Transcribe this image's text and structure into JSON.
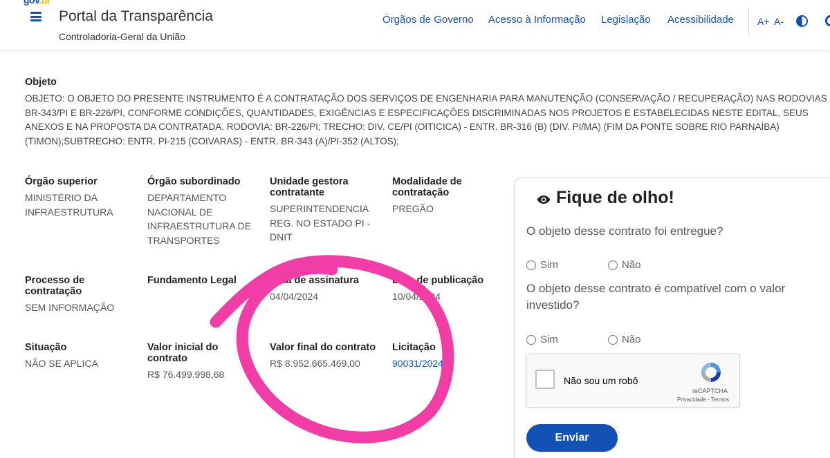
{
  "header": {
    "logo_part1": "gov",
    "logo_part2": ".br",
    "title": "Portal da Transparência",
    "subtitle": "Controladoria-Geral da União",
    "nav": [
      "Órgãos de Governo",
      "Acesso à Informação",
      "Legislação",
      "Acessibilidade"
    ],
    "font_increase": "A+",
    "font_decrease": "A-",
    "brand_color": "#1351b4"
  },
  "objeto": {
    "label": "Objeto",
    "text": "OBJETO: O OBJETO DO PRESENTE INSTRUMENTO É A CONTRATAÇÃO DOS SERVIÇOS DE ENGENHARIA PARA MANUTENÇÃO (CONSERVAÇÃO / RECUPERAÇÃO) NAS RODOVIAS BR-343/PI E BR-226/PI, CONFORME CONDIÇÕES, QUANTIDADES, EXIGÊNCIAS E ESPECIFICAÇÕES DISCRIMINADAS NOS PROJETOS E ESTABELECIDAS NESTE EDITAL, SEUS ANEXOS E NA PROPOSTA DA CONTRATADA. RODOVIA: BR-226/PI; TRECHO: DIV. CE/PI (OITICICA) - ENTR. BR-316 (B) (DIV. PI/MA) (FIM DA PONTE SOBRE RIO PARNAÍBA) (TIMON);SUBTRECHO: ENTR. PI-215 (COIVARAS) - ENTR. BR-343 (A)/PI-352 (ALTOS);"
  },
  "fields": {
    "orgao_superior": {
      "label": "Órgão superior",
      "value": "MINISTÉRIO DA INFRAESTRUTURA"
    },
    "orgao_subordinado": {
      "label": "Órgão subordinado",
      "value": "DEPARTAMENTO NACIONAL DE INFRAESTRUTURA DE TRANSPORTES"
    },
    "unidade_gestora": {
      "label": "Unidade gestora contratante",
      "value": "SUPERINTENDENCIA REG. NO ESTADO PI - DNIT"
    },
    "modalidade": {
      "label": "Modalidade de contratação",
      "value": "PREGÃO"
    },
    "processo": {
      "label": "Processo de contratação",
      "value": "SEM INFORMAÇÃO"
    },
    "fundamento": {
      "label": "Fundamento Legal",
      "value": ""
    },
    "data_assinatura": {
      "label": "Data de assinatura",
      "value": "04/04/2024"
    },
    "data_publicacao": {
      "label": "Data de publicação",
      "value": "10/04/2024"
    },
    "situacao": {
      "label": "Situação",
      "value": "NÃO SE APLICA"
    },
    "valor_inicial": {
      "label": "Valor inicial do contrato",
      "value": "R$ 76.499.998,68"
    },
    "valor_final": {
      "label": "Valor final do contrato",
      "value": "R$ 8.952.665.469,00"
    },
    "licitacao": {
      "label": "Licitação",
      "value": "90031/2024"
    }
  },
  "annotation_color": "#f23ca6",
  "fique_de_olho": {
    "title": "Fique de olho!",
    "question1": "O objeto desse contrato foi entregue?",
    "question2": "O objeto desse contrato é compatível com o valor investido?",
    "option_yes": "Sim",
    "option_no": "Não",
    "captcha_label": "Não sou um robô",
    "captcha_brand": "reCAPTCHA",
    "captcha_terms": "Privacidade - Termos",
    "submit": "Enviar"
  }
}
